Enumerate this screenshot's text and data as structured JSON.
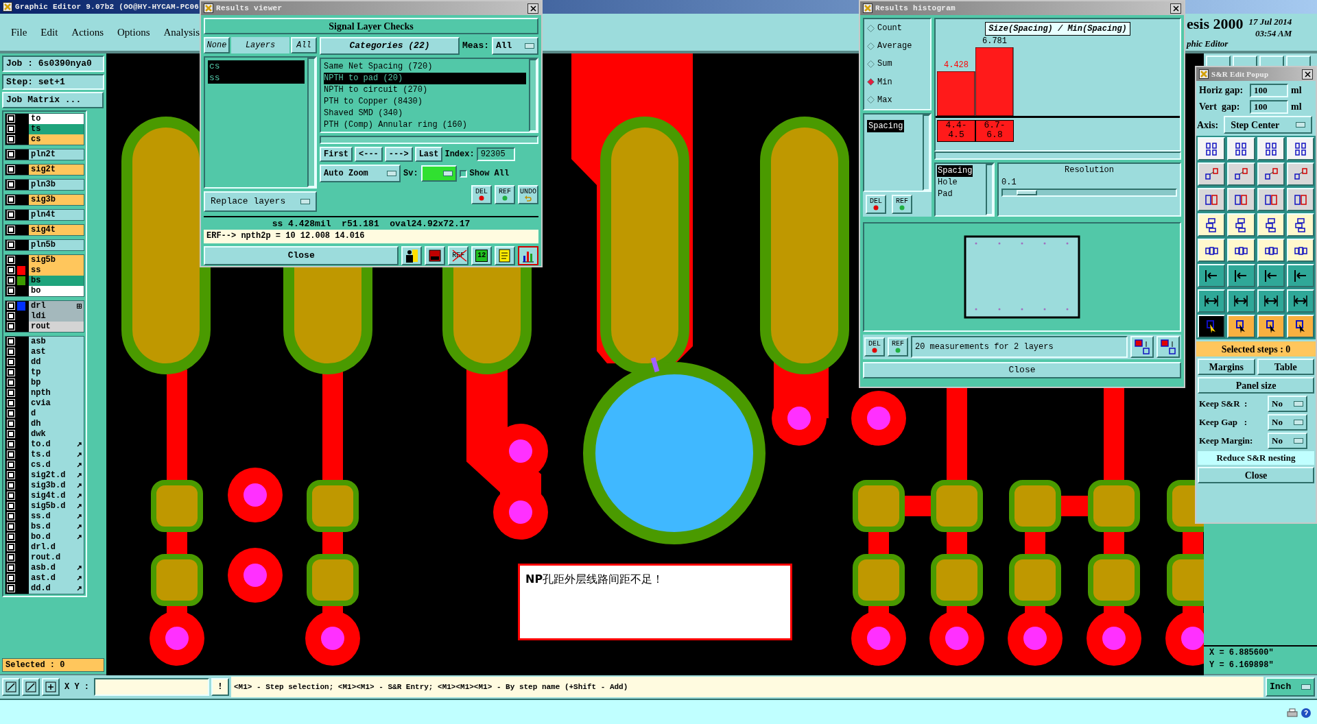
{
  "main_window": {
    "title": "Graphic Editor 9.07b2 (OO@HY-HYCAM-PC06",
    "menu": [
      "File",
      "Edit",
      "Actions",
      "Options",
      "Analysis"
    ],
    "brand": {
      "product": "esis 2000",
      "subtitle": "phic Editor",
      "date": "17 Jul 2014",
      "time": "03:54 AM"
    },
    "job": "Job : 6s0390nya0",
    "step": "Step: set+1",
    "job_matrix_button": "Job Matrix ...",
    "layer_groups": [
      {
        "layers": [
          {
            "name": "to",
            "kind": "silk",
            "checked": false
          },
          {
            "name": "ts",
            "kind": "mask",
            "checked": false
          },
          {
            "name": "cs",
            "kind": "signal",
            "checked": false
          }
        ]
      },
      {
        "layers": [
          {
            "name": "pln2t",
            "kind": "plane",
            "checked": false
          }
        ]
      },
      {
        "layers": [
          {
            "name": "sig2t",
            "kind": "signal",
            "checked": false
          }
        ]
      },
      {
        "layers": [
          {
            "name": "pln3b",
            "kind": "plane",
            "checked": false
          }
        ]
      },
      {
        "layers": [
          {
            "name": "sig3b",
            "kind": "signal",
            "checked": false
          }
        ]
      },
      {
        "layers": [
          {
            "name": "pln4t",
            "kind": "plane",
            "checked": false
          }
        ]
      },
      {
        "layers": [
          {
            "name": "sig4t",
            "kind": "signal",
            "checked": false
          }
        ]
      },
      {
        "layers": [
          {
            "name": "pln5b",
            "kind": "plane",
            "checked": false
          }
        ]
      },
      {
        "layers": [
          {
            "name": "sig5b",
            "kind": "signal",
            "checked": false
          },
          {
            "name": "ss",
            "kind": "signal",
            "checked": false,
            "color": "#ff0000"
          },
          {
            "name": "bs",
            "kind": "mask",
            "checked": false,
            "color": "#3c9a00"
          },
          {
            "name": "bo",
            "kind": "silk",
            "checked": false
          }
        ]
      },
      {
        "layers": [
          {
            "name": "drl",
            "kind": "drill",
            "checked": false,
            "color": "#0030ff",
            "expandable": true
          },
          {
            "name": "ldi",
            "kind": "drill",
            "checked": false
          },
          {
            "name": "rout",
            "kind": "rout",
            "checked": false
          }
        ]
      },
      {
        "layers": [
          {
            "name": "asb",
            "kind": "document",
            "checked": false
          },
          {
            "name": "ast",
            "kind": "document",
            "checked": false
          },
          {
            "name": "dd",
            "kind": "document",
            "checked": false
          },
          {
            "name": "tp",
            "kind": "document",
            "checked": false
          },
          {
            "name": "bp",
            "kind": "document",
            "checked": false
          },
          {
            "name": "npth",
            "kind": "document",
            "checked": false
          },
          {
            "name": "cvia",
            "kind": "document",
            "checked": false
          },
          {
            "name": "d",
            "kind": "document",
            "checked": false
          },
          {
            "name": "dh",
            "kind": "document",
            "checked": false
          },
          {
            "name": "dwk",
            "kind": "document",
            "checked": false
          },
          {
            "name": "to.d",
            "kind": "document",
            "checked": false,
            "linked": true
          },
          {
            "name": "ts.d",
            "kind": "document",
            "checked": false,
            "linked": true
          },
          {
            "name": "cs.d",
            "kind": "document",
            "checked": false,
            "linked": true
          },
          {
            "name": "sig2t.d",
            "kind": "document",
            "checked": false,
            "linked": true
          },
          {
            "name": "sig3b.d",
            "kind": "document",
            "checked": false,
            "linked": true
          },
          {
            "name": "sig4t.d",
            "kind": "document",
            "checked": false,
            "linked": true
          },
          {
            "name": "sig5b.d",
            "kind": "document",
            "checked": false,
            "linked": true
          },
          {
            "name": "ss.d",
            "kind": "document",
            "checked": false,
            "linked": true
          },
          {
            "name": "bs.d",
            "kind": "document",
            "checked": false,
            "linked": true
          },
          {
            "name": "bo.d",
            "kind": "document",
            "checked": false,
            "linked": true
          },
          {
            "name": "drl.d",
            "kind": "document",
            "checked": false
          },
          {
            "name": "rout.d",
            "kind": "document",
            "checked": false
          },
          {
            "name": "asb.d",
            "kind": "document",
            "checked": false,
            "linked": true
          },
          {
            "name": "ast.d",
            "kind": "document",
            "checked": false,
            "linked": true
          },
          {
            "name": "dd.d",
            "kind": "document",
            "checked": false,
            "linked": true
          }
        ]
      }
    ],
    "selected_count": "Selected : 0",
    "canvas_message": "**NP**孔距外层线路间距不足！",
    "coordinates": [
      "X = 6.885600\"",
      "Y = 6.169898\""
    ],
    "bottom_bar": {
      "xy_label": "X Y :",
      "alert_button": "!",
      "hint": "<M1> - Step selection; <M1><M1> - S&R Entry; <M1><M1><M1> - By step name (+Shift - Add)",
      "units": "Inch"
    }
  },
  "results_viewer": {
    "title": "Results viewer",
    "header": "Signal Layer Checks",
    "layer_buttons": [
      "None",
      "Layers",
      "All"
    ],
    "layers": [
      {
        "name": "cs",
        "selected": true
      },
      {
        "name": "ss",
        "selected": true
      }
    ],
    "replace_dropdown": "Replace layers",
    "categories_button": "Categories (22)",
    "meas_label": "Meas:",
    "meas_value": "All",
    "categories": [
      {
        "label": "Same Net Spacing (720)",
        "selected": false
      },
      {
        "label": "NPTH to pad (20)",
        "selected": true
      },
      {
        "label": "NPTH to circuit (270)",
        "selected": false
      },
      {
        "label": "PTH to Copper (8430)",
        "selected": false
      },
      {
        "label": "Shaved SMD (340)",
        "selected": false
      },
      {
        "label": "PTH (Comp) Annular ring (160)",
        "selected": false
      }
    ],
    "nav_buttons": [
      "First",
      "<---",
      "--->",
      "Last"
    ],
    "index_label": "Index:",
    "index_value": "92305",
    "zoom_dropdown": "Auto Zoom",
    "sv_label": "Sv:",
    "show_all": {
      "label": "Show All",
      "checked": false
    },
    "actions": [
      "DEL",
      "REF",
      "UNDO"
    ],
    "info": "ss 4.428mil  r51.181  oval24.92x72.17",
    "erf": "ERF--> npth2p = 10 12.008 14.016",
    "close": "Close",
    "tools": [
      {
        "kind": "figure",
        "selected": false
      },
      {
        "kind": "report",
        "selected": false
      },
      {
        "kind": "crossed",
        "label": "REF",
        "selected": false
      },
      {
        "kind": "numbered",
        "label": "12",
        "selected": false
      },
      {
        "kind": "notes",
        "selected": false
      },
      {
        "kind": "chart",
        "selected": true
      }
    ]
  },
  "results_histogram": {
    "title": "Results histogram",
    "modes": [
      {
        "label": "Count",
        "selected": false
      },
      {
        "label": "Average",
        "selected": false
      },
      {
        "label": "Sum",
        "selected": false
      },
      {
        "label": "Min",
        "selected": true
      },
      {
        "label": "Max",
        "selected": false
      }
    ],
    "measures": [
      {
        "label": "Spacing",
        "selected": true
      }
    ],
    "actions": [
      "DEL",
      "REF"
    ],
    "chart_data": {
      "type": "bar",
      "title": "Size(Spacing) / Min(Spacing)",
      "categories": [
        "4.4-4.5",
        "6.7-6.8"
      ],
      "values": [
        4.428,
        6.781
      ],
      "data_labels": true
    },
    "fields": [
      {
        "label": "Spacing",
        "selected": true
      },
      {
        "label": "Hole",
        "selected": false
      },
      {
        "label": "Pad",
        "selected": false
      }
    ],
    "resolution_label": "Resolution",
    "resolution_value": "0.1",
    "resolution": {
      "level": 0.08
    },
    "preview_actions": [
      "DEL",
      "REF"
    ],
    "summary": "20 measurements for 2 layers",
    "close": "Close"
  },
  "sr_edit_popup": {
    "title": "S&R Edit Popup",
    "gaps": [
      {
        "label": "Horiz gap:",
        "value": "100",
        "unit": "ml"
      },
      {
        "label": "Vert  gap:",
        "value": "100",
        "unit": "ml"
      }
    ],
    "axis_label": "Axis:",
    "axis_value": "Step Center",
    "selected_steps": "Selected steps : 0",
    "buttons": [
      "Margins",
      "Table"
    ],
    "panel_size": "Panel size",
    "keeps": [
      {
        "label": "Keep S&R  :",
        "value": "No"
      },
      {
        "label": "Keep Gap   :",
        "value": "No"
      },
      {
        "label": "Keep Margin:",
        "value": "No"
      }
    ],
    "reduce": "Reduce S&R nesting",
    "close": "Close"
  }
}
